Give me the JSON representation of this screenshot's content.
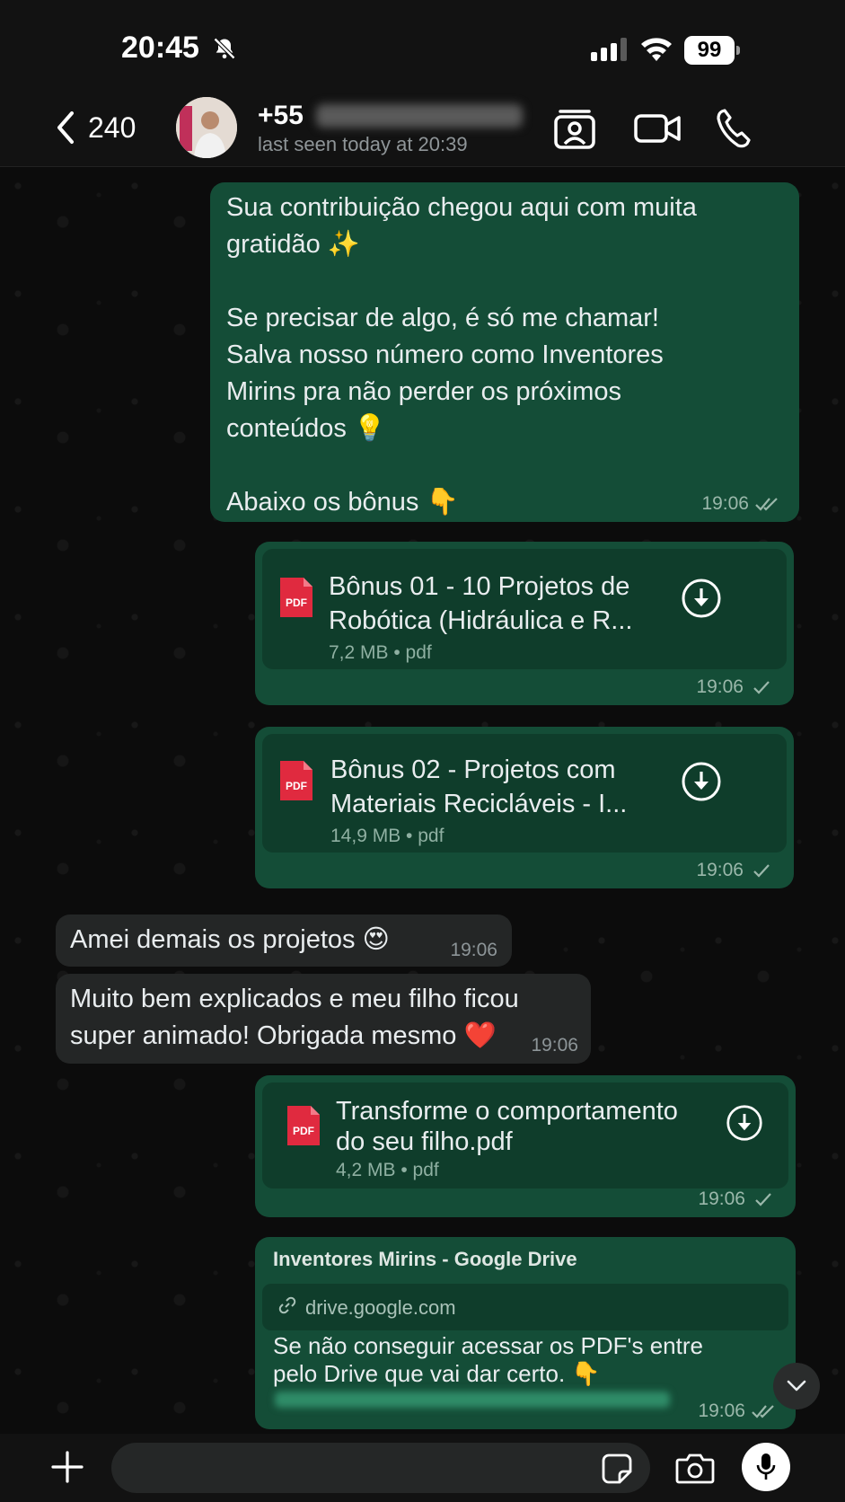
{
  "status_bar": {
    "time": "20:45",
    "battery": "99"
  },
  "header": {
    "back_count": "240",
    "contact_name": "+55",
    "last_seen": "last seen today at 20:39"
  },
  "messages": [
    {
      "direction": "out",
      "text": "Sua contribuição chegou aqui com muita\ngratidão ✨\n\nSe precisar de algo, é só me chamar!\nSalva nosso número como Inventores\nMirins pra não perder os próximos\nconteúdos 💡\n\nAbaixo os bônus 👇",
      "time": "19:06",
      "status": "read"
    },
    {
      "direction": "out",
      "type": "document",
      "title_line1": "Bônus 01 - 10 Projetos de",
      "title_line2": "Robótica (Hidráulica e R...",
      "size": "7,2 MB • pdf",
      "time": "19:06",
      "status": "sent"
    },
    {
      "direction": "out",
      "type": "document",
      "title_line1": "Bônus 02 - Projetos com",
      "title_line2": "Materiais Recicláveis - I...",
      "size": "14,9 MB • pdf",
      "time": "19:06",
      "status": "sent"
    },
    {
      "direction": "in",
      "text": "Amei demais os projetos 😍",
      "time": "19:06"
    },
    {
      "direction": "in",
      "text": "Muito bem explicados e meu filho ficou\nsuper animado! Obrigada mesmo ❤️",
      "time": "19:06"
    },
    {
      "direction": "out",
      "type": "document",
      "title_line1": "Transforme o comportamento",
      "title_line2": "do seu filho.pdf",
      "size": "4,2 MB • pdf",
      "time": "19:06",
      "status": "sent"
    },
    {
      "direction": "out",
      "type": "link",
      "site_title": "Inventores Mirins - Google Drive",
      "domain": "drive.google.com",
      "text": "Se não conseguir acessar os PDF's entre\npelo Drive que vai dar certo. 👇",
      "time": "19:06",
      "status": "read"
    }
  ],
  "pdf_badge": "PDF",
  "colors": {
    "outgoing": "#144d37",
    "incoming": "#242626",
    "background": "#0c0c0c"
  }
}
